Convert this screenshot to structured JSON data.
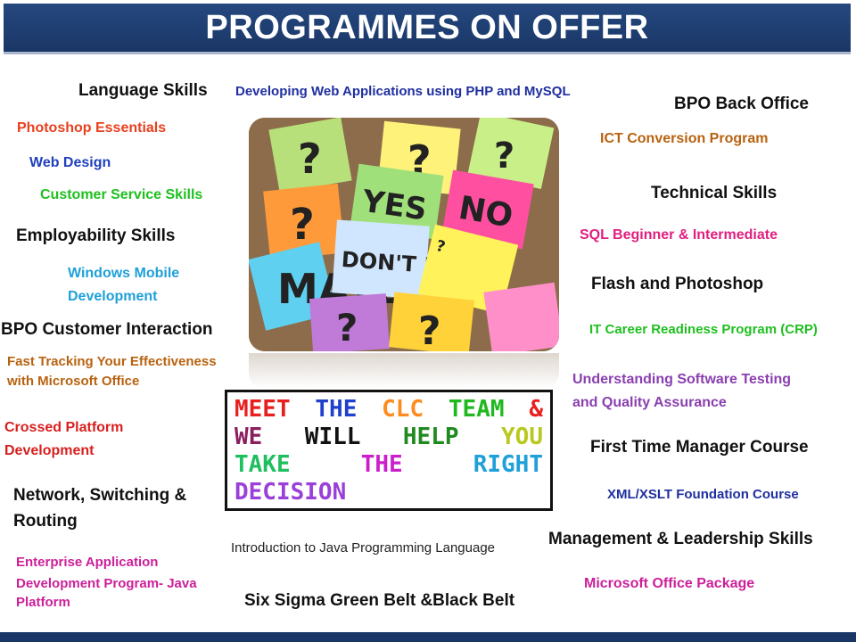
{
  "banner": {
    "title": "PROGRAMMES ON OFFER"
  },
  "programmes": {
    "language_skills": "Language Skills",
    "web_php": "Developing Web Applications using PHP and MySQL",
    "bpo_back_office": "BPO Back Office",
    "photoshop_essentials": "Photoshop  Essentials",
    "ict_conversion": "ICT Conversion  Program",
    "web_design": "Web Design",
    "customer_service": "Customer Service Skills",
    "technical_skills": "Technical Skills",
    "employability": "Employability Skills",
    "sql": "SQL Beginner & Intermediate",
    "windows_mobile_1": "Windows Mobile",
    "windows_mobile_2": "Development",
    "flash_photoshop": "Flash and Photoshop",
    "bpo_customer": "BPO Customer Interaction",
    "it_career": "IT Career Readiness Program (CRP)",
    "fast_tracking_1": "Fast Tracking Your Effectiveness",
    "fast_tracking_2": "with Microsoft Office",
    "software_testing_1": "Understanding  Software Testing",
    "software_testing_2": "and Quality  Assurance",
    "crossed_platform_1": "Crossed  Platform",
    "crossed_platform_2": "Development",
    "first_time_manager": "First Time Manager Course",
    "network_1": "Network, Switching &",
    "network_2": "Routing",
    "xml_xslt": "XML/XSLT Foundation Course",
    "java_intro": "Introduction to Java Programming Language",
    "management": "Management & Leadership Skills",
    "enterprise_1": "Enterprise Application",
    "enterprise_2": "Development Program- Java",
    "enterprise_3": "Platform",
    "ms_office": "Microsoft  Office Package",
    "six_sigma": "Six Sigma Green  Belt &Black Belt"
  },
  "photo": {
    "notes": [
      "?",
      "?",
      "?",
      "?",
      "YES",
      "NO",
      "MAYBE",
      "DON'T KNOW",
      "?",
      "?",
      "?"
    ]
  },
  "slogan": {
    "line1": [
      "MEET",
      "THE",
      "CLC",
      "TEAM",
      "&"
    ],
    "line2": [
      "WE",
      "WILL",
      "HELP",
      "YOU"
    ],
    "line3": [
      "TAKE",
      "THE",
      "RIGHT"
    ],
    "line4": [
      "DECISION"
    ]
  },
  "colors": {
    "banner": "#1f3f73",
    "orange_red": "#e8411f",
    "blue": "#1f3fbf",
    "green": "#1fbf1f",
    "cyan": "#1fa0d8",
    "brown": "#b8620f",
    "pink": "#e01f7f",
    "purple": "#8a3fb0",
    "red": "#d81f1f",
    "magenta": "#cc1f99"
  }
}
